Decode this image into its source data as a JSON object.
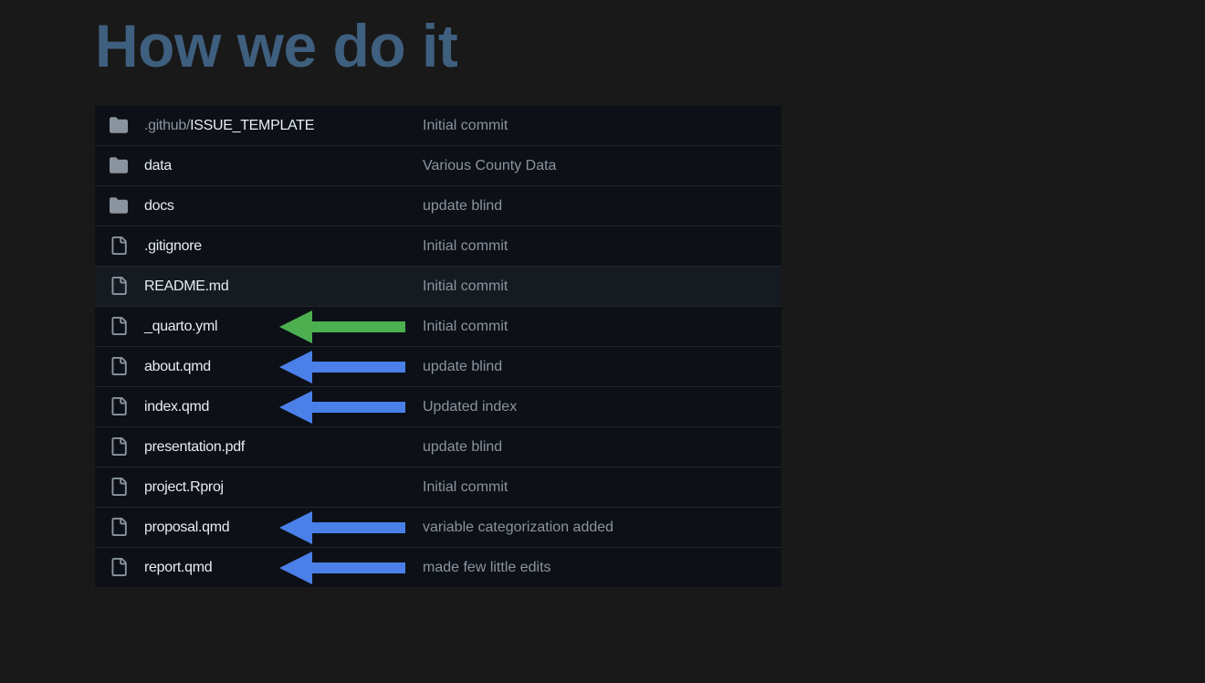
{
  "title": "How we do it",
  "colors": {
    "background": "#191919",
    "title": "#3f5f7f",
    "list_background": "#0d1117",
    "row_hover": "#161b22",
    "arrow_green": "#4caf50",
    "arrow_blue": "#4a80e8"
  },
  "files": [
    {
      "type": "folder",
      "icon": "folder-icon",
      "name_prefix": ".github/",
      "name": "ISSUE_TEMPLATE",
      "commit": "Initial commit",
      "arrow": null
    },
    {
      "type": "folder",
      "icon": "folder-icon",
      "name_prefix": "",
      "name": "data",
      "commit": "Various County Data",
      "arrow": null
    },
    {
      "type": "folder",
      "icon": "folder-icon",
      "name_prefix": "",
      "name": "docs",
      "commit": "update blind",
      "arrow": null
    },
    {
      "type": "file",
      "icon": "file-icon",
      "name_prefix": "",
      "name": ".gitignore",
      "commit": "Initial commit",
      "arrow": null
    },
    {
      "type": "file",
      "icon": "file-icon",
      "name_prefix": "",
      "name": "README.md",
      "commit": "Initial commit",
      "arrow": null,
      "highlighted": true
    },
    {
      "type": "file",
      "icon": "file-icon",
      "name_prefix": "",
      "name": "_quarto.yml",
      "commit": "Initial commit",
      "arrow": "green"
    },
    {
      "type": "file",
      "icon": "file-icon",
      "name_prefix": "",
      "name": "about.qmd",
      "commit": "update blind",
      "arrow": "blue"
    },
    {
      "type": "file",
      "icon": "file-icon",
      "name_prefix": "",
      "name": "index.qmd",
      "commit": "Updated index",
      "arrow": "blue"
    },
    {
      "type": "file",
      "icon": "file-icon",
      "name_prefix": "",
      "name": "presentation.pdf",
      "commit": "update blind",
      "arrow": null
    },
    {
      "type": "file",
      "icon": "file-icon",
      "name_prefix": "",
      "name": "project.Rproj",
      "commit": "Initial commit",
      "arrow": null
    },
    {
      "type": "file",
      "icon": "file-icon",
      "name_prefix": "",
      "name": "proposal.qmd",
      "commit": "variable categorization added",
      "arrow": "blue"
    },
    {
      "type": "file",
      "icon": "file-icon",
      "name_prefix": "",
      "name": "report.qmd",
      "commit": "made few little edits",
      "arrow": "blue"
    }
  ]
}
